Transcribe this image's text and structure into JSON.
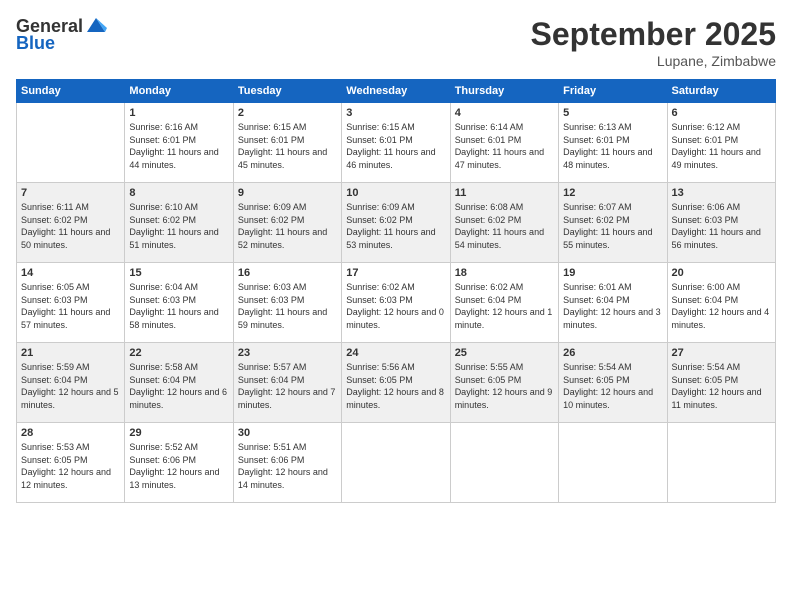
{
  "logo": {
    "general": "General",
    "blue": "Blue"
  },
  "title": {
    "month": "September 2025",
    "location": "Lupane, Zimbabwe"
  },
  "weekdays": [
    "Sunday",
    "Monday",
    "Tuesday",
    "Wednesday",
    "Thursday",
    "Friday",
    "Saturday"
  ],
  "weeks": [
    [
      {
        "day": "",
        "sunrise": "",
        "sunset": "",
        "daylight": ""
      },
      {
        "day": "1",
        "sunrise": "Sunrise: 6:16 AM",
        "sunset": "Sunset: 6:01 PM",
        "daylight": "Daylight: 11 hours and 44 minutes."
      },
      {
        "day": "2",
        "sunrise": "Sunrise: 6:15 AM",
        "sunset": "Sunset: 6:01 PM",
        "daylight": "Daylight: 11 hours and 45 minutes."
      },
      {
        "day": "3",
        "sunrise": "Sunrise: 6:15 AM",
        "sunset": "Sunset: 6:01 PM",
        "daylight": "Daylight: 11 hours and 46 minutes."
      },
      {
        "day": "4",
        "sunrise": "Sunrise: 6:14 AM",
        "sunset": "Sunset: 6:01 PM",
        "daylight": "Daylight: 11 hours and 47 minutes."
      },
      {
        "day": "5",
        "sunrise": "Sunrise: 6:13 AM",
        "sunset": "Sunset: 6:01 PM",
        "daylight": "Daylight: 11 hours and 48 minutes."
      },
      {
        "day": "6",
        "sunrise": "Sunrise: 6:12 AM",
        "sunset": "Sunset: 6:01 PM",
        "daylight": "Daylight: 11 hours and 49 minutes."
      }
    ],
    [
      {
        "day": "7",
        "sunrise": "Sunrise: 6:11 AM",
        "sunset": "Sunset: 6:02 PM",
        "daylight": "Daylight: 11 hours and 50 minutes."
      },
      {
        "day": "8",
        "sunrise": "Sunrise: 6:10 AM",
        "sunset": "Sunset: 6:02 PM",
        "daylight": "Daylight: 11 hours and 51 minutes."
      },
      {
        "day": "9",
        "sunrise": "Sunrise: 6:09 AM",
        "sunset": "Sunset: 6:02 PM",
        "daylight": "Daylight: 11 hours and 52 minutes."
      },
      {
        "day": "10",
        "sunrise": "Sunrise: 6:09 AM",
        "sunset": "Sunset: 6:02 PM",
        "daylight": "Daylight: 11 hours and 53 minutes."
      },
      {
        "day": "11",
        "sunrise": "Sunrise: 6:08 AM",
        "sunset": "Sunset: 6:02 PM",
        "daylight": "Daylight: 11 hours and 54 minutes."
      },
      {
        "day": "12",
        "sunrise": "Sunrise: 6:07 AM",
        "sunset": "Sunset: 6:02 PM",
        "daylight": "Daylight: 11 hours and 55 minutes."
      },
      {
        "day": "13",
        "sunrise": "Sunrise: 6:06 AM",
        "sunset": "Sunset: 6:03 PM",
        "daylight": "Daylight: 11 hours and 56 minutes."
      }
    ],
    [
      {
        "day": "14",
        "sunrise": "Sunrise: 6:05 AM",
        "sunset": "Sunset: 6:03 PM",
        "daylight": "Daylight: 11 hours and 57 minutes."
      },
      {
        "day": "15",
        "sunrise": "Sunrise: 6:04 AM",
        "sunset": "Sunset: 6:03 PM",
        "daylight": "Daylight: 11 hours and 58 minutes."
      },
      {
        "day": "16",
        "sunrise": "Sunrise: 6:03 AM",
        "sunset": "Sunset: 6:03 PM",
        "daylight": "Daylight: 11 hours and 59 minutes."
      },
      {
        "day": "17",
        "sunrise": "Sunrise: 6:02 AM",
        "sunset": "Sunset: 6:03 PM",
        "daylight": "Daylight: 12 hours and 0 minutes."
      },
      {
        "day": "18",
        "sunrise": "Sunrise: 6:02 AM",
        "sunset": "Sunset: 6:04 PM",
        "daylight": "Daylight: 12 hours and 1 minute."
      },
      {
        "day": "19",
        "sunrise": "Sunrise: 6:01 AM",
        "sunset": "Sunset: 6:04 PM",
        "daylight": "Daylight: 12 hours and 3 minutes."
      },
      {
        "day": "20",
        "sunrise": "Sunrise: 6:00 AM",
        "sunset": "Sunset: 6:04 PM",
        "daylight": "Daylight: 12 hours and 4 minutes."
      }
    ],
    [
      {
        "day": "21",
        "sunrise": "Sunrise: 5:59 AM",
        "sunset": "Sunset: 6:04 PM",
        "daylight": "Daylight: 12 hours and 5 minutes."
      },
      {
        "day": "22",
        "sunrise": "Sunrise: 5:58 AM",
        "sunset": "Sunset: 6:04 PM",
        "daylight": "Daylight: 12 hours and 6 minutes."
      },
      {
        "day": "23",
        "sunrise": "Sunrise: 5:57 AM",
        "sunset": "Sunset: 6:04 PM",
        "daylight": "Daylight: 12 hours and 7 minutes."
      },
      {
        "day": "24",
        "sunrise": "Sunrise: 5:56 AM",
        "sunset": "Sunset: 6:05 PM",
        "daylight": "Daylight: 12 hours and 8 minutes."
      },
      {
        "day": "25",
        "sunrise": "Sunrise: 5:55 AM",
        "sunset": "Sunset: 6:05 PM",
        "daylight": "Daylight: 12 hours and 9 minutes."
      },
      {
        "day": "26",
        "sunrise": "Sunrise: 5:54 AM",
        "sunset": "Sunset: 6:05 PM",
        "daylight": "Daylight: 12 hours and 10 minutes."
      },
      {
        "day": "27",
        "sunrise": "Sunrise: 5:54 AM",
        "sunset": "Sunset: 6:05 PM",
        "daylight": "Daylight: 12 hours and 11 minutes."
      }
    ],
    [
      {
        "day": "28",
        "sunrise": "Sunrise: 5:53 AM",
        "sunset": "Sunset: 6:05 PM",
        "daylight": "Daylight: 12 hours and 12 minutes."
      },
      {
        "day": "29",
        "sunrise": "Sunrise: 5:52 AM",
        "sunset": "Sunset: 6:06 PM",
        "daylight": "Daylight: 12 hours and 13 minutes."
      },
      {
        "day": "30",
        "sunrise": "Sunrise: 5:51 AM",
        "sunset": "Sunset: 6:06 PM",
        "daylight": "Daylight: 12 hours and 14 minutes."
      },
      {
        "day": "",
        "sunrise": "",
        "sunset": "",
        "daylight": ""
      },
      {
        "day": "",
        "sunrise": "",
        "sunset": "",
        "daylight": ""
      },
      {
        "day": "",
        "sunrise": "",
        "sunset": "",
        "daylight": ""
      },
      {
        "day": "",
        "sunrise": "",
        "sunset": "",
        "daylight": ""
      }
    ]
  ]
}
